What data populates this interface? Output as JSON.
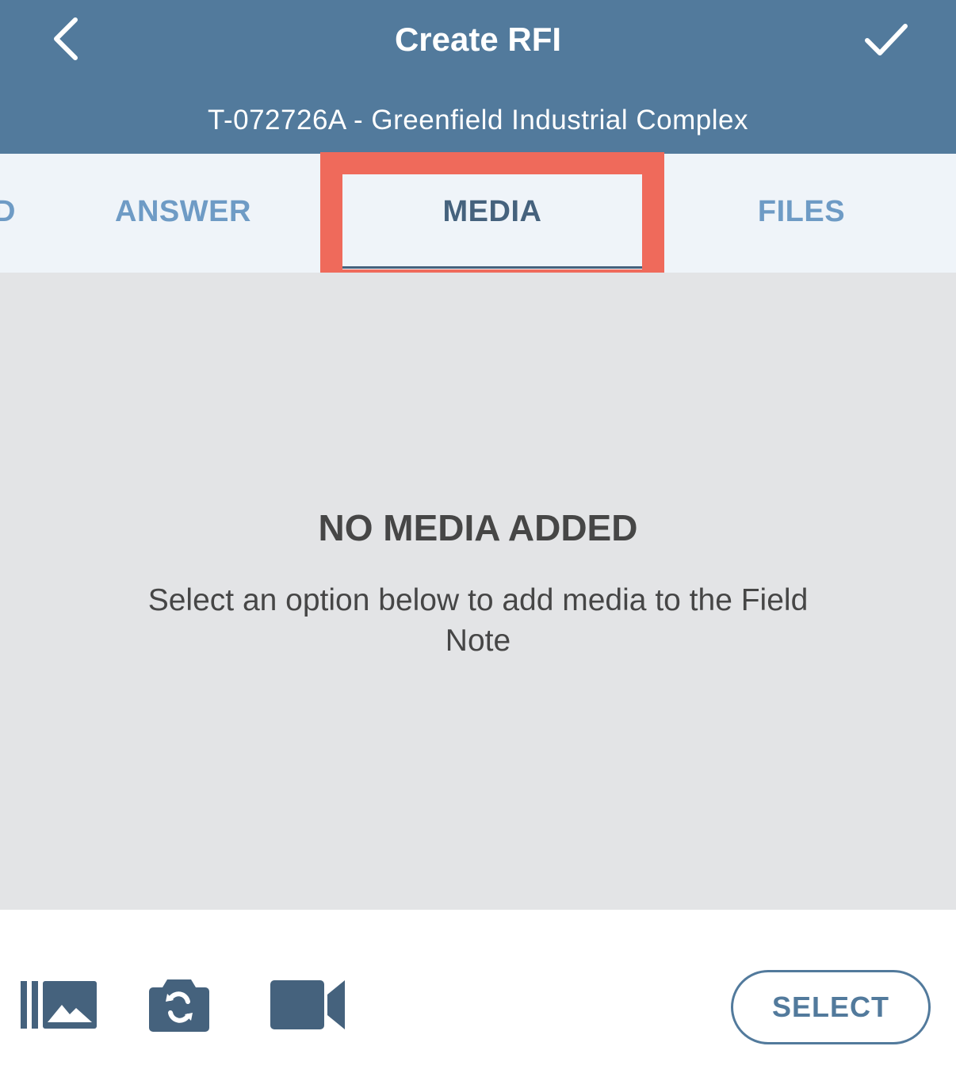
{
  "header": {
    "title": "Create RFI",
    "subtitle": "T-072726A - Greenfield Industrial Complex",
    "back_icon": "chevron-left-icon",
    "confirm_icon": "checkmark-icon"
  },
  "tabs": [
    {
      "label": "D",
      "active": false
    },
    {
      "label": "ANSWER",
      "active": false
    },
    {
      "label": "MEDIA",
      "active": true
    },
    {
      "label": "FILES",
      "active": false
    }
  ],
  "empty_state": {
    "title": "NO MEDIA ADDED",
    "message": "Select an option below to add media to the Field Note"
  },
  "toolbar": {
    "gallery_icon": "photo-gallery-icon",
    "camera_icon": "camera-switch-icon",
    "video_icon": "video-camera-icon",
    "select_label": "SELECT"
  },
  "colors": {
    "header": "#527a9c",
    "tab_active": "#45627d",
    "tab_inactive": "#6e9bc5",
    "highlight": "#ef6a5b",
    "content_bg": "#e3e4e6"
  }
}
